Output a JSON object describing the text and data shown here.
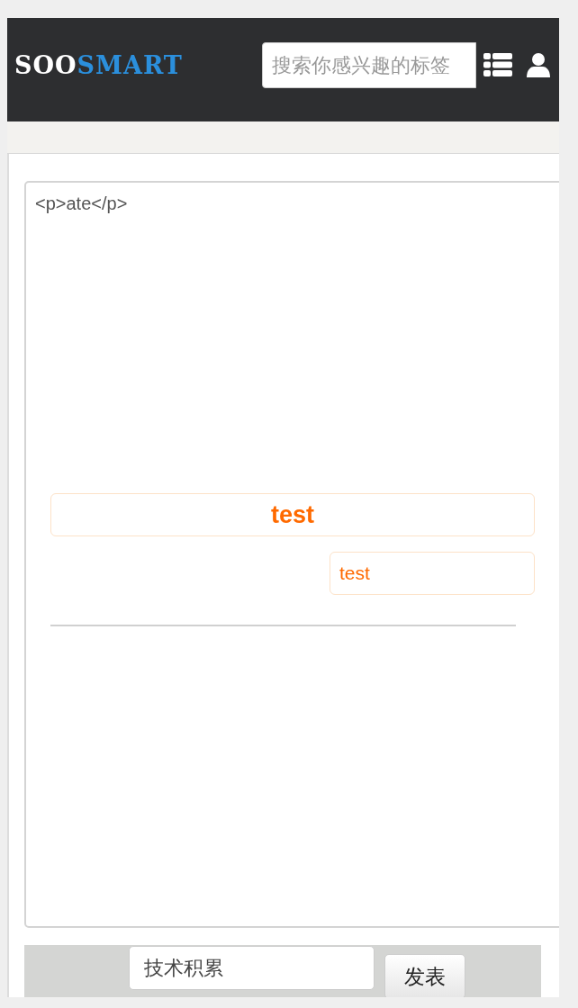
{
  "header": {
    "logo": {
      "part_1": "SOO",
      "part_2": "SMART"
    },
    "search": {
      "placeholder": "搜索你感兴趣的标签"
    }
  },
  "editor": {
    "content": "<p>ate</p>",
    "blocks": [
      {
        "kind": "title",
        "text": "test"
      },
      {
        "kind": "tag",
        "text": "test"
      }
    ]
  },
  "footer": {
    "category": {
      "value": "技术积累"
    },
    "submit": "发表"
  }
}
